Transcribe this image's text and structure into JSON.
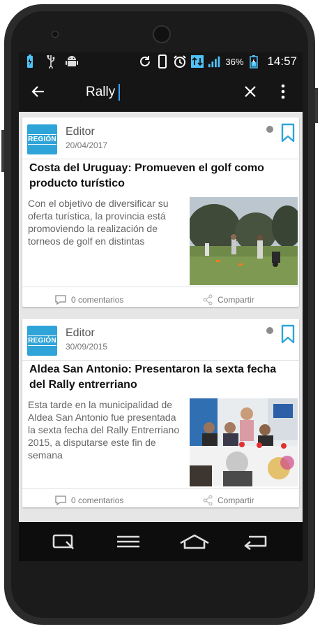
{
  "status_bar": {
    "battery_percent": "36%",
    "time": "14:57",
    "icons_left": [
      "battery-charging-icon",
      "usb-icon",
      "android-icon"
    ],
    "icons_right": [
      "sync-icon",
      "vibrate-icon",
      "alarm-icon",
      "data-transfer-icon",
      "signal-icon",
      "battery-icon"
    ]
  },
  "toolbar": {
    "search_value": "Rally"
  },
  "posts": [
    {
      "logo_text": "REGIÓN",
      "author": "Editor",
      "date": "20/04/2017",
      "title": "Costa del Uruguay: Promueven el golf como producto turístico",
      "excerpt": "Con el objetivo de diversificar su oferta turística, la provincia está promoviendo la realización de torneos de golf en distintas",
      "comments": "0 comentarios",
      "share": "Compartir"
    },
    {
      "logo_text": "REGIÓN",
      "author": "Editor",
      "date": "30/09/2015",
      "title": "Aldea San Antonio: Presentaron la sexta fecha del Rally entrerriano",
      "excerpt": "Esta tarde en la municipalidad de Aldea San Antonio fue presentada la sexta fecha del Rally Entrerriano 2015, a disputarse este fin de semana",
      "comments": "0 comentarios",
      "share": "Compartir"
    }
  ],
  "colors": {
    "accent": "#2fa4d8",
    "toolbar": "#151515",
    "background": "#e6e6e6"
  }
}
